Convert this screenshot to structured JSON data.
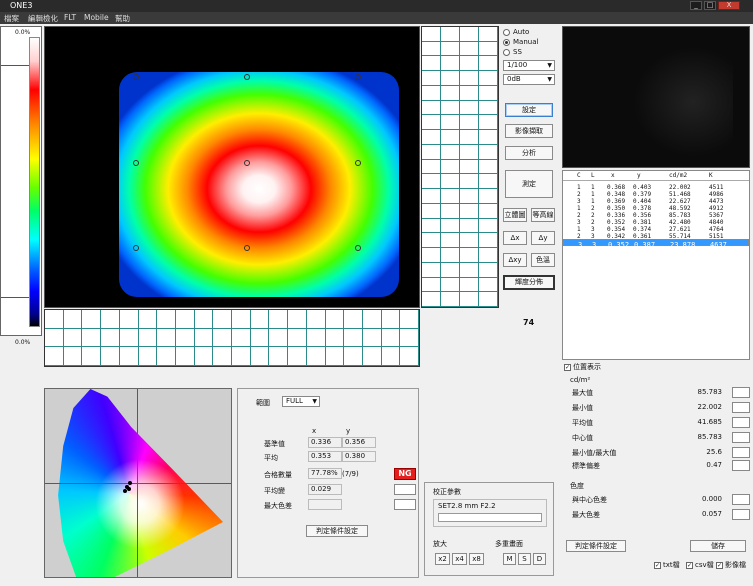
{
  "window": {
    "title": "ONE3",
    "controls": [
      "_",
      "□",
      "X"
    ]
  },
  "menu": [
    "檔案",
    "編輯檢化",
    "FLT",
    "Mobile",
    "幫助"
  ],
  "scale": {
    "top_label": "0.0%",
    "bottom_label": "0.0%"
  },
  "capture": {
    "modes": [
      "Auto",
      "Manual",
      "SS"
    ],
    "selected_mode": "Manual",
    "shutter": "1/100",
    "gain": "0dB"
  },
  "buttons": {
    "settings": "設定",
    "capture": "影像擷取",
    "analyze": "分析",
    "measure": "測定",
    "stereo": "立體圖",
    "contour": "等高線",
    "dx": "Δx",
    "dy": "Δy",
    "dxy": "Δxy",
    "color_temp": "色溫",
    "lum_dist": "輝度分佈"
  },
  "counter": "74",
  "table": {
    "headers": [
      "C",
      "L",
      "x",
      "y",
      "cd/m2",
      "K"
    ],
    "rows": [
      [
        "1",
        "1",
        "0.368",
        "0.403",
        "22.002",
        "4511"
      ],
      [
        "2",
        "1",
        "0.348",
        "0.379",
        "51.468",
        "4986"
      ],
      [
        "3",
        "1",
        "0.369",
        "0.404",
        "22.627",
        "4473"
      ],
      [
        "1",
        "2",
        "0.350",
        "0.378",
        "48.592",
        "4912"
      ],
      [
        "2",
        "2",
        "0.336",
        "0.356",
        "85.783",
        "5367"
      ],
      [
        "3",
        "2",
        "0.352",
        "0.381",
        "42.480",
        "4840"
      ],
      [
        "1",
        "3",
        "0.354",
        "0.374",
        "27.621",
        "4764"
      ],
      [
        "2",
        "3",
        "0.342",
        "0.361",
        "55.714",
        "5151"
      ],
      [
        "3",
        "3",
        "0.352",
        "0.387",
        "23.878",
        "4637"
      ]
    ],
    "selected_row": 8
  },
  "position_display": {
    "label": "位置表示",
    "checked": true,
    "unit": "cd/m²"
  },
  "stats": [
    {
      "label": "最大值",
      "value": "85.783"
    },
    {
      "label": "最小值",
      "value": "22.002"
    },
    {
      "label": "平均值",
      "value": "41.685"
    },
    {
      "label": "中心值",
      "value": "85.783"
    },
    {
      "label": "最小值/最大值",
      "value": "25.6"
    },
    {
      "label": "標準偏差",
      "value": "0.47"
    }
  ],
  "color_section": {
    "title": "色度",
    "rows": [
      {
        "label": "與中心色差",
        "value": "0.000"
      },
      {
        "label": "最大色差",
        "value": "0.057"
      }
    ]
  },
  "right_bottom": {
    "judge_settings": "判定條件設定",
    "save": "儲存",
    "checks": [
      {
        "label": "txt檔",
        "checked": true
      },
      {
        "label": "csv檔",
        "checked": true
      },
      {
        "label": "影像檔",
        "checked": true
      }
    ]
  },
  "judge": {
    "range_label": "範圍",
    "range_value": "FULL",
    "col_x": "x",
    "col_y": "y",
    "ref_label": "基準值",
    "ref_x": "0.336",
    "ref_y": "0.356",
    "avg_label": "平均",
    "avg_x": "0.353",
    "avg_y": "0.380",
    "pass_label": "合格數量",
    "pass_pct": "77.78%",
    "pass_count": "(7/9)",
    "result": "NG",
    "avg_diff_label": "平均變",
    "avg_diff": "0.029",
    "max_diff_label": "最大色差",
    "max_diff": "",
    "settings_button": "判定條件設定"
  },
  "camera_params": {
    "title": "校正參數",
    "value": "SET2.8 mm F2.2",
    "zoom_label": "放大",
    "zoom_buttons": [
      "x2",
      "x4",
      "x8"
    ],
    "multi_label": "多重畫面",
    "multi_buttons": [
      "M",
      "S",
      "D"
    ]
  }
}
